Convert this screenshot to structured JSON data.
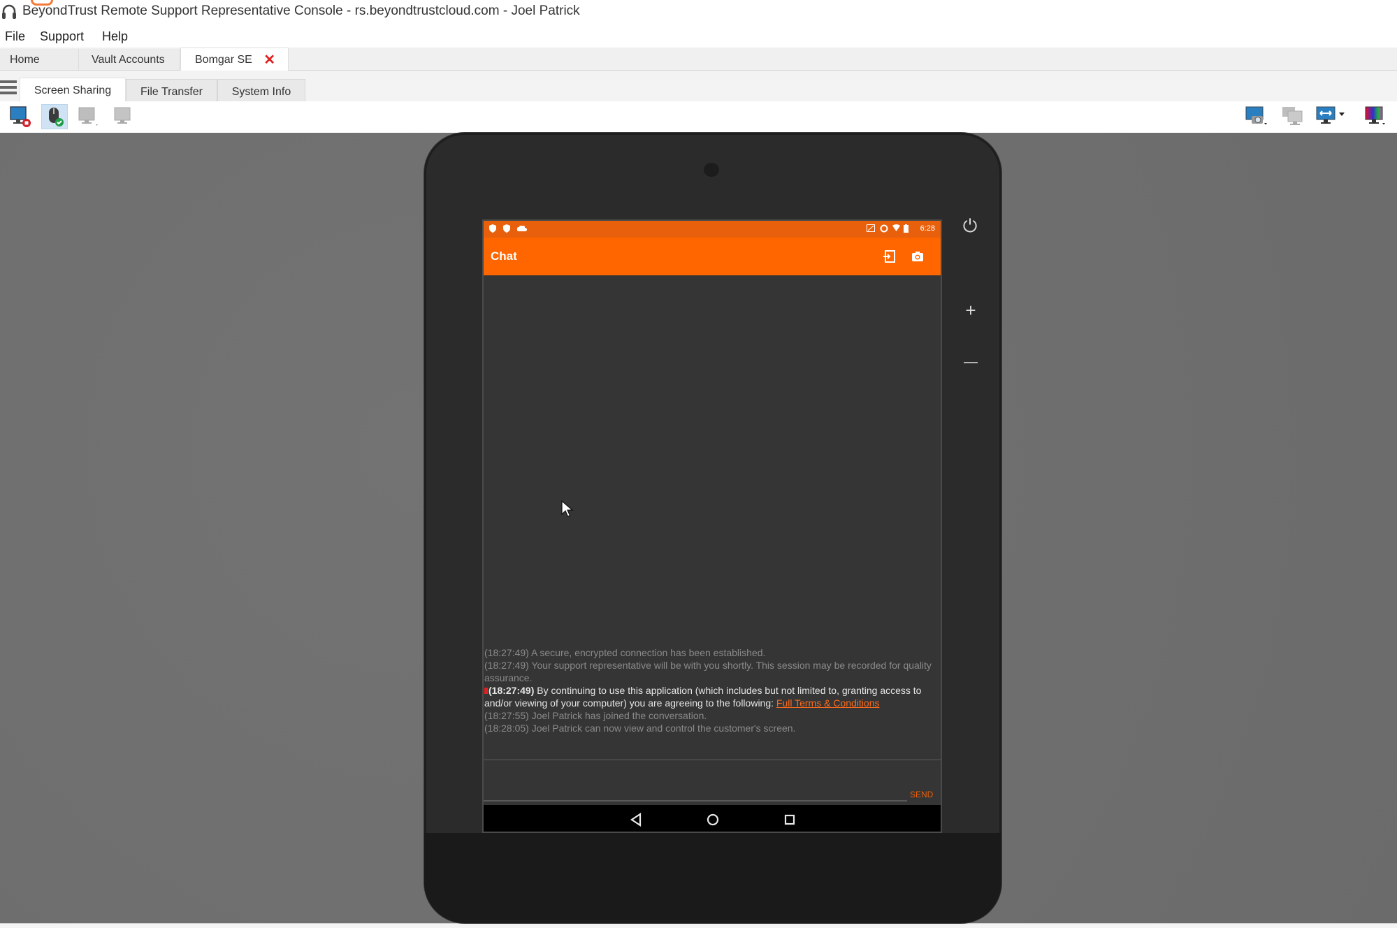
{
  "window": {
    "title": "BeyondTrust Remote Support Representative Console - rs.beyondtrustcloud.com - Joel Patrick",
    "app_icon": "headset-icon"
  },
  "menu": {
    "items": [
      {
        "label": "File"
      },
      {
        "label": "Support"
      },
      {
        "label": "Help"
      }
    ]
  },
  "session_tabs": {
    "items": [
      {
        "label": "Home",
        "active": false
      },
      {
        "label": "Vault Accounts",
        "active": false
      },
      {
        "label": "Bomgar SE",
        "active": true,
        "closable": true
      }
    ],
    "close_glyph": "✕"
  },
  "sub_tabs": {
    "items": [
      {
        "label": "Screen Sharing",
        "active": true
      },
      {
        "label": "File Transfer",
        "active": false
      },
      {
        "label": "System Info",
        "active": false
      }
    ]
  },
  "toolbar": {
    "left": [
      {
        "icon": "stop-screen-sharing-icon",
        "enabled": true,
        "active": false
      },
      {
        "icon": "mouse-control-icon",
        "enabled": true,
        "active": true
      },
      {
        "icon": "remote-control-disabled-icon",
        "enabled": false
      },
      {
        "icon": "view-only-disabled-icon",
        "enabled": false
      }
    ],
    "right": [
      {
        "icon": "screenshot-icon"
      },
      {
        "icon": "multiple-monitors-icon",
        "enabled": false
      },
      {
        "icon": "fit-to-screen-icon",
        "has_dropdown": true
      },
      {
        "icon": "color-depth-icon"
      }
    ]
  },
  "device": {
    "side_buttons": [
      {
        "icon": "power-icon",
        "glyph": "⏻"
      },
      {
        "icon": "volume-up-icon",
        "glyph": "+"
      },
      {
        "icon": "volume-down-icon",
        "glyph": "—"
      }
    ],
    "status_bar": {
      "left_icons": [
        "shield-icon",
        "shield-icon",
        "cloud-icon"
      ],
      "right_icons": [
        "cast-icon",
        "sync-icon",
        "wifi-icon",
        "battery-icon"
      ],
      "time": "6:28"
    },
    "app_bar": {
      "title": "Chat",
      "actions": [
        "exit-session-icon",
        "camera-icon"
      ]
    },
    "chat": {
      "messages": [
        {
          "time": "(18:27:49)",
          "text": " A secure, encrypted connection has been established.",
          "emphasis": false
        },
        {
          "time": "(18:27:49)",
          "text": " Your support representative will be with you shortly. This session may be recorded for quality assurance.",
          "emphasis": false
        },
        {
          "time": "(18:27:49)",
          "text": " By continuing to use this application (which includes but not limited to, granting access to and/or viewing of your computer) you are agreeing to the following: ",
          "emphasis": true,
          "link": "Full Terms & Conditions"
        },
        {
          "time": "(18:27:55)",
          "text": " Joel Patrick has joined the conversation.",
          "emphasis": false
        },
        {
          "time": "(18:28:05)",
          "text": " Joel Patrick can now view and control the customer's screen.",
          "emphasis": false
        }
      ],
      "input_value": "",
      "send_label": "SEND"
    },
    "nav_bar": [
      "back-icon",
      "home-icon",
      "recents-icon"
    ]
  },
  "colors": {
    "accent_orange": "#ff6600",
    "status_orange": "#e8600b",
    "close_red": "#e02020",
    "viewport_grey": "#6e6e6e",
    "device_body": "#2b2b2b"
  }
}
